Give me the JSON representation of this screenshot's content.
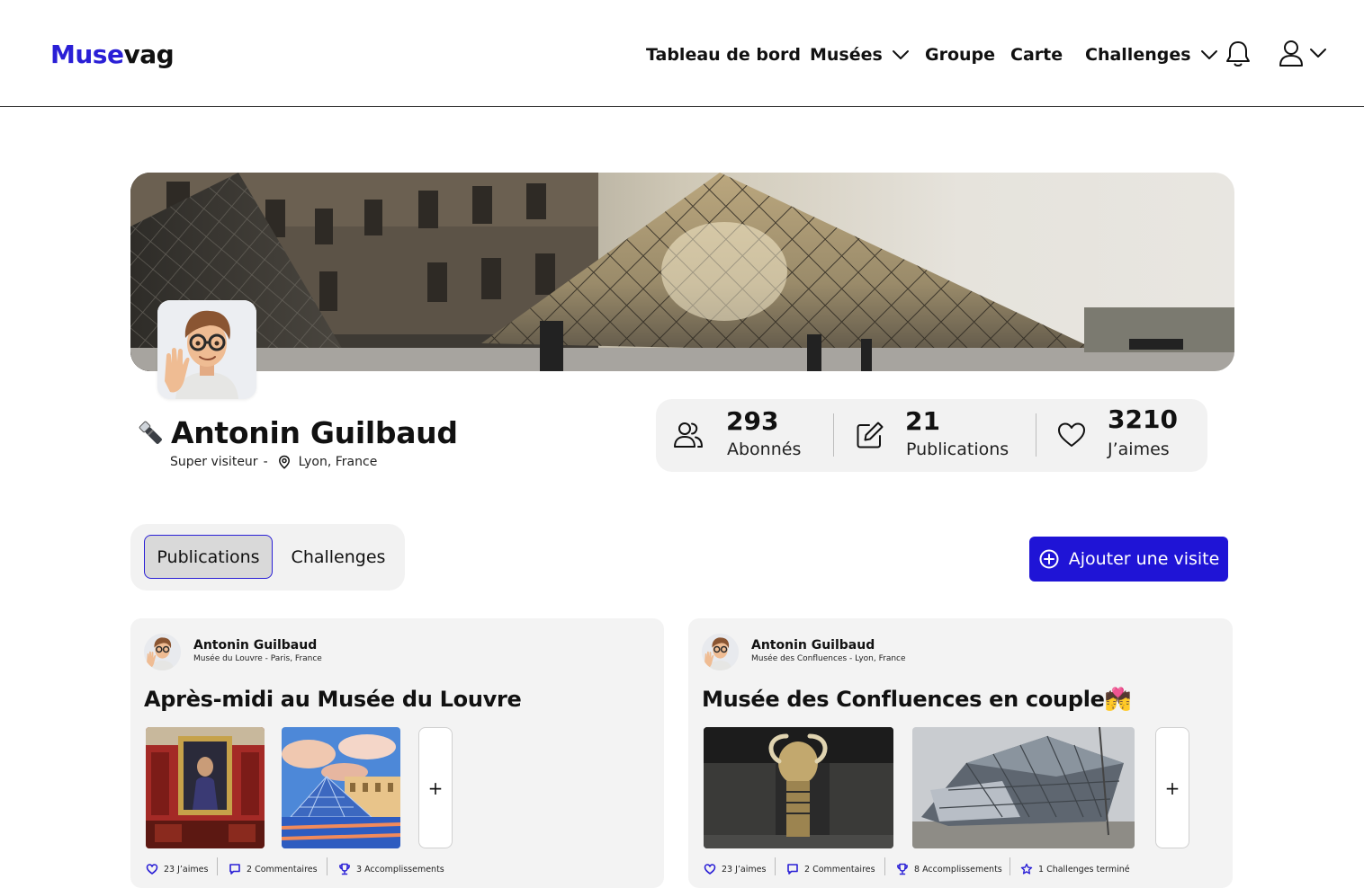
{
  "brand": {
    "logo_accent": "Muse",
    "logo_rest": "vag",
    "accent_color": "#2a1fd6",
    "button_color": "#1f14d6"
  },
  "nav": {
    "dashboard": "Tableau de bord",
    "museums": "Musées",
    "group": "Groupe",
    "map": "Carte",
    "challenges": "Challenges",
    "notifications_icon": "bell-icon",
    "account_icon": "user-icon"
  },
  "profile": {
    "name": "Antonin Guilbaud",
    "rank_icon": "flashlight-icon",
    "rank": "Super visiteur",
    "separator": "-",
    "location": "Lyon, France"
  },
  "stats": [
    {
      "value": "293",
      "label": "Abonnés",
      "icon": "users-icon"
    },
    {
      "value": "21",
      "label": "Publications",
      "icon": "edit-icon"
    },
    {
      "value": "3210",
      "label": "J’aimes",
      "icon": "heart-icon"
    }
  ],
  "tabs": {
    "active": "Publications",
    "other": "Challenges"
  },
  "add_visit": "Ajouter une visite",
  "posts": [
    {
      "author": "Antonin Guilbaud",
      "place": "Musée du Louvre - Paris, France",
      "title": "Après-midi au Musée du Louvre",
      "more": "+",
      "meta": {
        "likes": "23 J’aimes",
        "comments": "2 Commentaires",
        "achievements": "3 Accomplissements"
      }
    },
    {
      "author": "Antonin Guilbaud",
      "place": "Musée des Confluences - Lyon, France",
      "title": "Musée des Confluences en couple",
      "title_emoji": "💏",
      "more": "+",
      "meta": {
        "likes": "23 J’aimes",
        "comments": "2 Commentaires",
        "achievements": "8 Accomplissements",
        "challenges": "1 Challenges terminé"
      }
    }
  ]
}
